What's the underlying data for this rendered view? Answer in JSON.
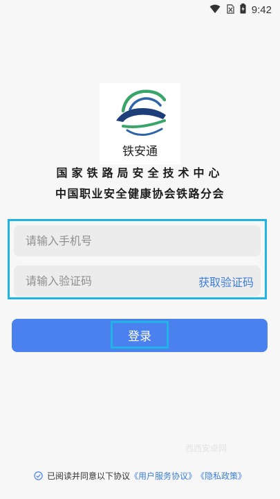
{
  "status_bar": {
    "time": "9:42",
    "icons": [
      "wifi-icon",
      "no-sim-icon",
      "battery-icon"
    ]
  },
  "logo": {
    "text": "铁安通",
    "colors": {
      "green": "#3aa56a",
      "blue": "#2d63a8",
      "dark_blue": "#1f3f7a"
    }
  },
  "org": {
    "line1": "国家铁路局安全技术中心",
    "line2": "中国职业安全健康协会铁路分会"
  },
  "form": {
    "phone_placeholder": "请输入手机号",
    "code_placeholder": "请输入验证码",
    "get_code_label": "获取验证码"
  },
  "login": {
    "label": "登录"
  },
  "watermark": "西西安卓网",
  "agreement": {
    "text": "已阅读并同意以下协议",
    "user_agreement": "《用户服务协议》",
    "privacy_policy": "《隐私政策》"
  },
  "colors": {
    "accent": "#4b80ef",
    "link": "#3d7fd6",
    "highlight_frame": "#1fb3e6",
    "field_bg": "#ececec",
    "page_bg": "#f7f7f7"
  }
}
